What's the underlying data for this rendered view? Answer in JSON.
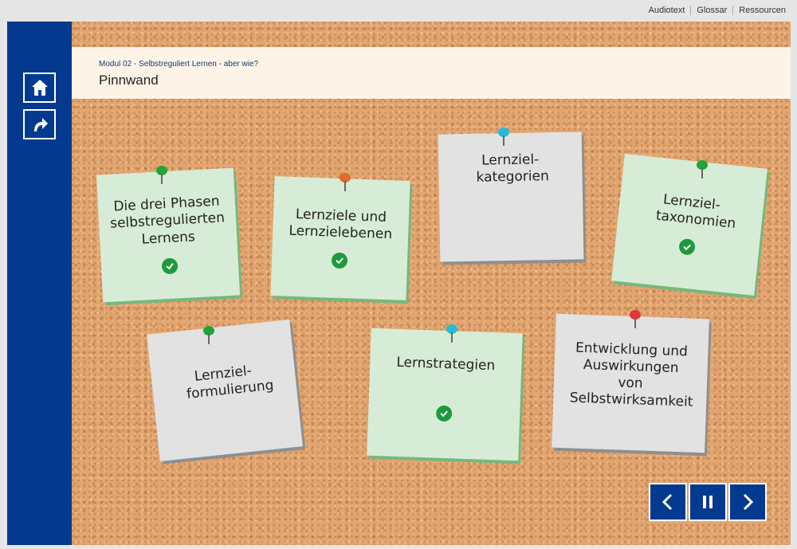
{
  "topnav": {
    "audio": "Audiotext",
    "glossary": "Glossar",
    "resources": "Ressourcen"
  },
  "header": {
    "breadcrumb": "Modul 02 - Selbstreguliert Lernen - aber wie?",
    "title": "Pinnwand"
  },
  "sidebar": {
    "home_icon": "home-icon",
    "back_icon": "return-arrow-icon"
  },
  "notes": [
    {
      "label": "Die drei Phasen selbstregulierten Lernens",
      "state": "done",
      "pin_color": "#22a33a"
    },
    {
      "label": "Lernziele und Lernzielebenen",
      "state": "done",
      "pin_color": "#e06a2a"
    },
    {
      "label": "Lernziel-kategorien",
      "state": "open",
      "pin_color": "#27b9d8"
    },
    {
      "label": "Lernziel-taxonomien",
      "state": "done",
      "pin_color": "#22a33a"
    },
    {
      "label": "Lernziel-formulierung",
      "state": "open",
      "pin_color": "#22a33a"
    },
    {
      "label": "Lernstrategien",
      "state": "done",
      "pin_color": "#27b9d8"
    },
    {
      "label": "Entwicklung und Auswirkungen von Selbstwirksamkeit",
      "state": "open",
      "pin_color": "#e0363a"
    }
  ],
  "controls": {
    "prev_icon": "chevron-left-icon",
    "pause_icon": "pause-icon",
    "next_icon": "chevron-right-icon"
  },
  "colors": {
    "primary": "#033a8f",
    "done_note": "#d7ecd6",
    "open_note": "#e2e2e2",
    "check": "#1e9a3c"
  }
}
